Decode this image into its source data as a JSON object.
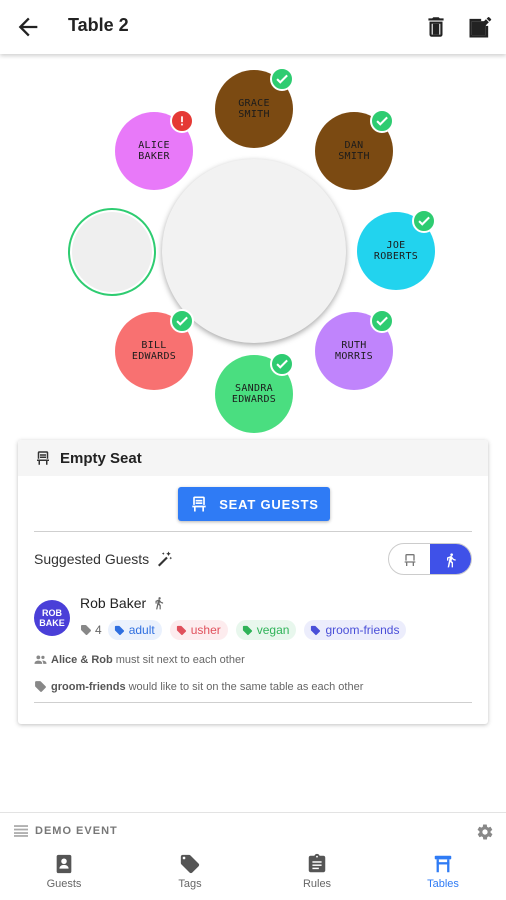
{
  "appbar": {
    "title": "Table 2"
  },
  "seats": [
    {
      "name": "GRACE\nSMITH",
      "color": "#7b4a12",
      "status": "ok"
    },
    {
      "name": "DAN\nSMITH",
      "color": "#7b4a12",
      "status": "ok"
    },
    {
      "name": "JOE\nROBERTS",
      "color": "#22d3ee",
      "status": "ok"
    },
    {
      "name": "RUTH\nMORRIS",
      "color": "#c084fc",
      "status": "ok"
    },
    {
      "name": "SANDRA\nEDWARDS",
      "color": "#4ade80",
      "status": "ok"
    },
    {
      "name": "BILL\nEDWARDS",
      "color": "#f87171",
      "status": "ok"
    },
    {
      "name": "",
      "color": "#efefef",
      "status": "empty"
    },
    {
      "name": "ALICE\nBAKER",
      "color": "#e879f9",
      "status": "error"
    }
  ],
  "card": {
    "header": "Empty Seat",
    "seat_button": "SEAT GUESTS",
    "suggested_label": "Suggested Guests",
    "guest": {
      "avatar_text": "ROB\nBAKE",
      "name": "Rob Baker",
      "count": "4",
      "tags": [
        {
          "label": "adult",
          "color": "#2f6fe0",
          "bg": "#eaf1fd"
        },
        {
          "label": "usher",
          "color": "#e0505c",
          "bg": "#fdecee"
        },
        {
          "label": "vegan",
          "color": "#2fb358",
          "bg": "#e8f7ed"
        },
        {
          "label": "groom-friends",
          "color": "#4a4fd8",
          "bg": "#ecedfc"
        }
      ]
    },
    "rules": [
      {
        "bold": "Alice & Rob",
        "text": "must sit next to each other"
      },
      {
        "bold": "groom-friends",
        "text": "would like to sit on the same table as each other"
      }
    ]
  },
  "bottom": {
    "event_name": "DEMO EVENT",
    "nav": [
      {
        "label": "Guests",
        "icon": "guests-icon"
      },
      {
        "label": "Tags",
        "icon": "tags-icon"
      },
      {
        "label": "Rules",
        "icon": "rules-icon"
      },
      {
        "label": "Tables",
        "icon": "tables-icon",
        "active": true
      }
    ]
  },
  "colors": {
    "accent": "#2f7bf5",
    "ok": "#2ecc71",
    "error": "#e53935",
    "toggle_active": "#3f51e8"
  }
}
